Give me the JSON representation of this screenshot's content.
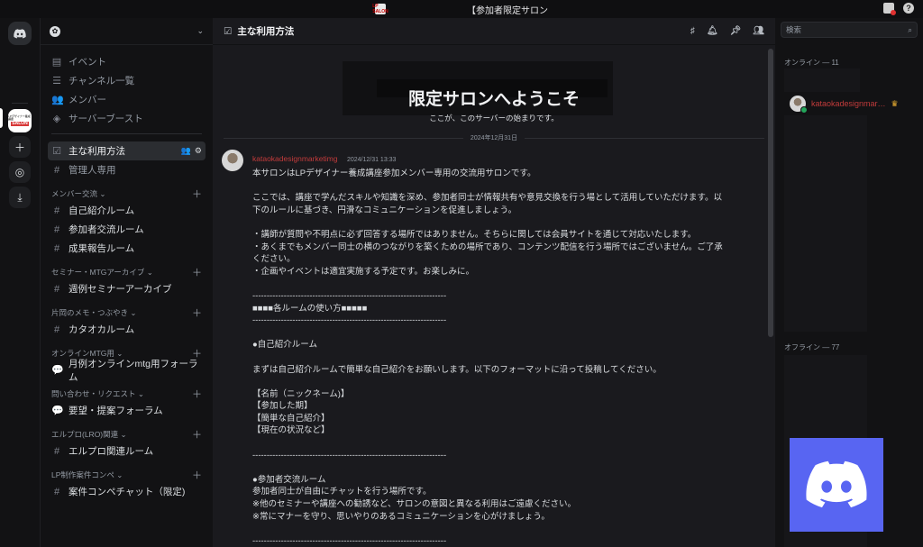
{
  "titlebar": {
    "app_badge": "LP SALON",
    "title": "【参加者限定サロン"
  },
  "rail": {
    "server_badge_top": "LPデザイナー養成講座",
    "server_badge_name": "SALON"
  },
  "server": {
    "icon": "✿"
  },
  "nav": [
    {
      "icon": "▤",
      "label": "イベント"
    },
    {
      "icon": "☰",
      "label": "チャンネル一覧"
    },
    {
      "icon": "👥",
      "label": "メンバー"
    },
    {
      "icon": "◈",
      "label": "サーバーブースト"
    }
  ],
  "channels_top": [
    {
      "icon": "☑",
      "label": "主な利用方法"
    },
    {
      "icon": "#",
      "label": "管理人専用"
    }
  ],
  "categories": [
    {
      "name": "メンバー交流 ⌄",
      "items": [
        {
          "icon": "#",
          "label": "自己紹介ルーム"
        },
        {
          "icon": "#",
          "label": "参加者交流ルーム"
        },
        {
          "icon": "#",
          "label": "成果報告ルーム"
        }
      ]
    },
    {
      "name": "セミナー・MTGアーカイブ ⌄",
      "items": [
        {
          "icon": "#",
          "label": "週例セミナーアーカイブ"
        }
      ]
    },
    {
      "name": "片岡のメモ・つぶやき ⌄",
      "items": [
        {
          "icon": "#",
          "label": "カタオカルーム"
        }
      ]
    },
    {
      "name": "オンラインMTG用 ⌄",
      "items": [
        {
          "icon": "💬",
          "label": "月例オンラインmtg用フォーラム"
        }
      ]
    },
    {
      "name": "問い合わせ・リクエスト ⌄",
      "items": [
        {
          "icon": "💬",
          "label": "要望・提案フォーラム"
        }
      ]
    },
    {
      "name": "エルプロ(LRO)関連 ⌄",
      "items": [
        {
          "icon": "#",
          "label": "エルプロ関連ルーム"
        }
      ]
    },
    {
      "name": "LP制作案件コンペ ⌄",
      "items": [
        {
          "icon": "#",
          "label": "案件コンペチャット（限定)"
        }
      ]
    }
  ],
  "header": {
    "icon": "☑",
    "channel": "主な利用方法"
  },
  "welcome": {
    "title": "限定サロンへようこそ",
    "subtitle": "ここが、このサーバーの始まりです。"
  },
  "date_divider": "2024年12月31日",
  "message": {
    "author": "kataokadesignmarketimg",
    "timestamp": "2024/12/31 13:33",
    "lines": [
      "本サロンはLPデザイナー養成講座参加メンバー専用の交流用サロンです。",
      "",
      "ここでは、講座で学んだスキルや知識を深め、参加者同士が情報共有や意見交換を行う場として活用していただけます。以",
      "下のルールに基づき、円滑なコミュニケーションを促進しましょう。",
      "",
      "・講師が質問や不明点に必ず回答する場所ではありません。そちらに関しては会員サイトを通じて対応いたします。",
      "・あくまでもメンバー同士の横のつながりを築くための場所であり、コンテンツ配信を行う場所ではございません。ご了承",
      "ください。",
      "・企画やイベントは適宜実施する予定です。お楽しみに。",
      "",
      "--------------------------------------------------------------------",
      "■■■■各ルームの使い方■■■■■",
      "--------------------------------------------------------------------",
      "",
      "●自己紹介ルーム",
      "",
      "まずは自己紹介ルームで簡単な自己紹介をお願いします。以下のフォーマットに沿って投稿してください。",
      "",
      "【名前（ニックネーム)】",
      "【参加した期】",
      "【簡単な自己紹介】",
      "【現在の状況など】",
      "",
      "--------------------------------------------------------------------",
      "",
      "●参加者交流ルーム",
      "参加者同士が自由にチャットを行う場所です。",
      "※他のセミナーや講座への勧誘など、サロンの意図と異なる利用はご遠慮ください。",
      "※常にマナーを守り、思いやりのあるコミュニケーションを心がけましょう。",
      "",
      "--------------------------------------------------------------------"
    ]
  },
  "members": {
    "search_placeholder": "検索",
    "online": "オンライン — 11",
    "offline": "オフライン — 77",
    "member_name": "kataokadesignmar…"
  }
}
